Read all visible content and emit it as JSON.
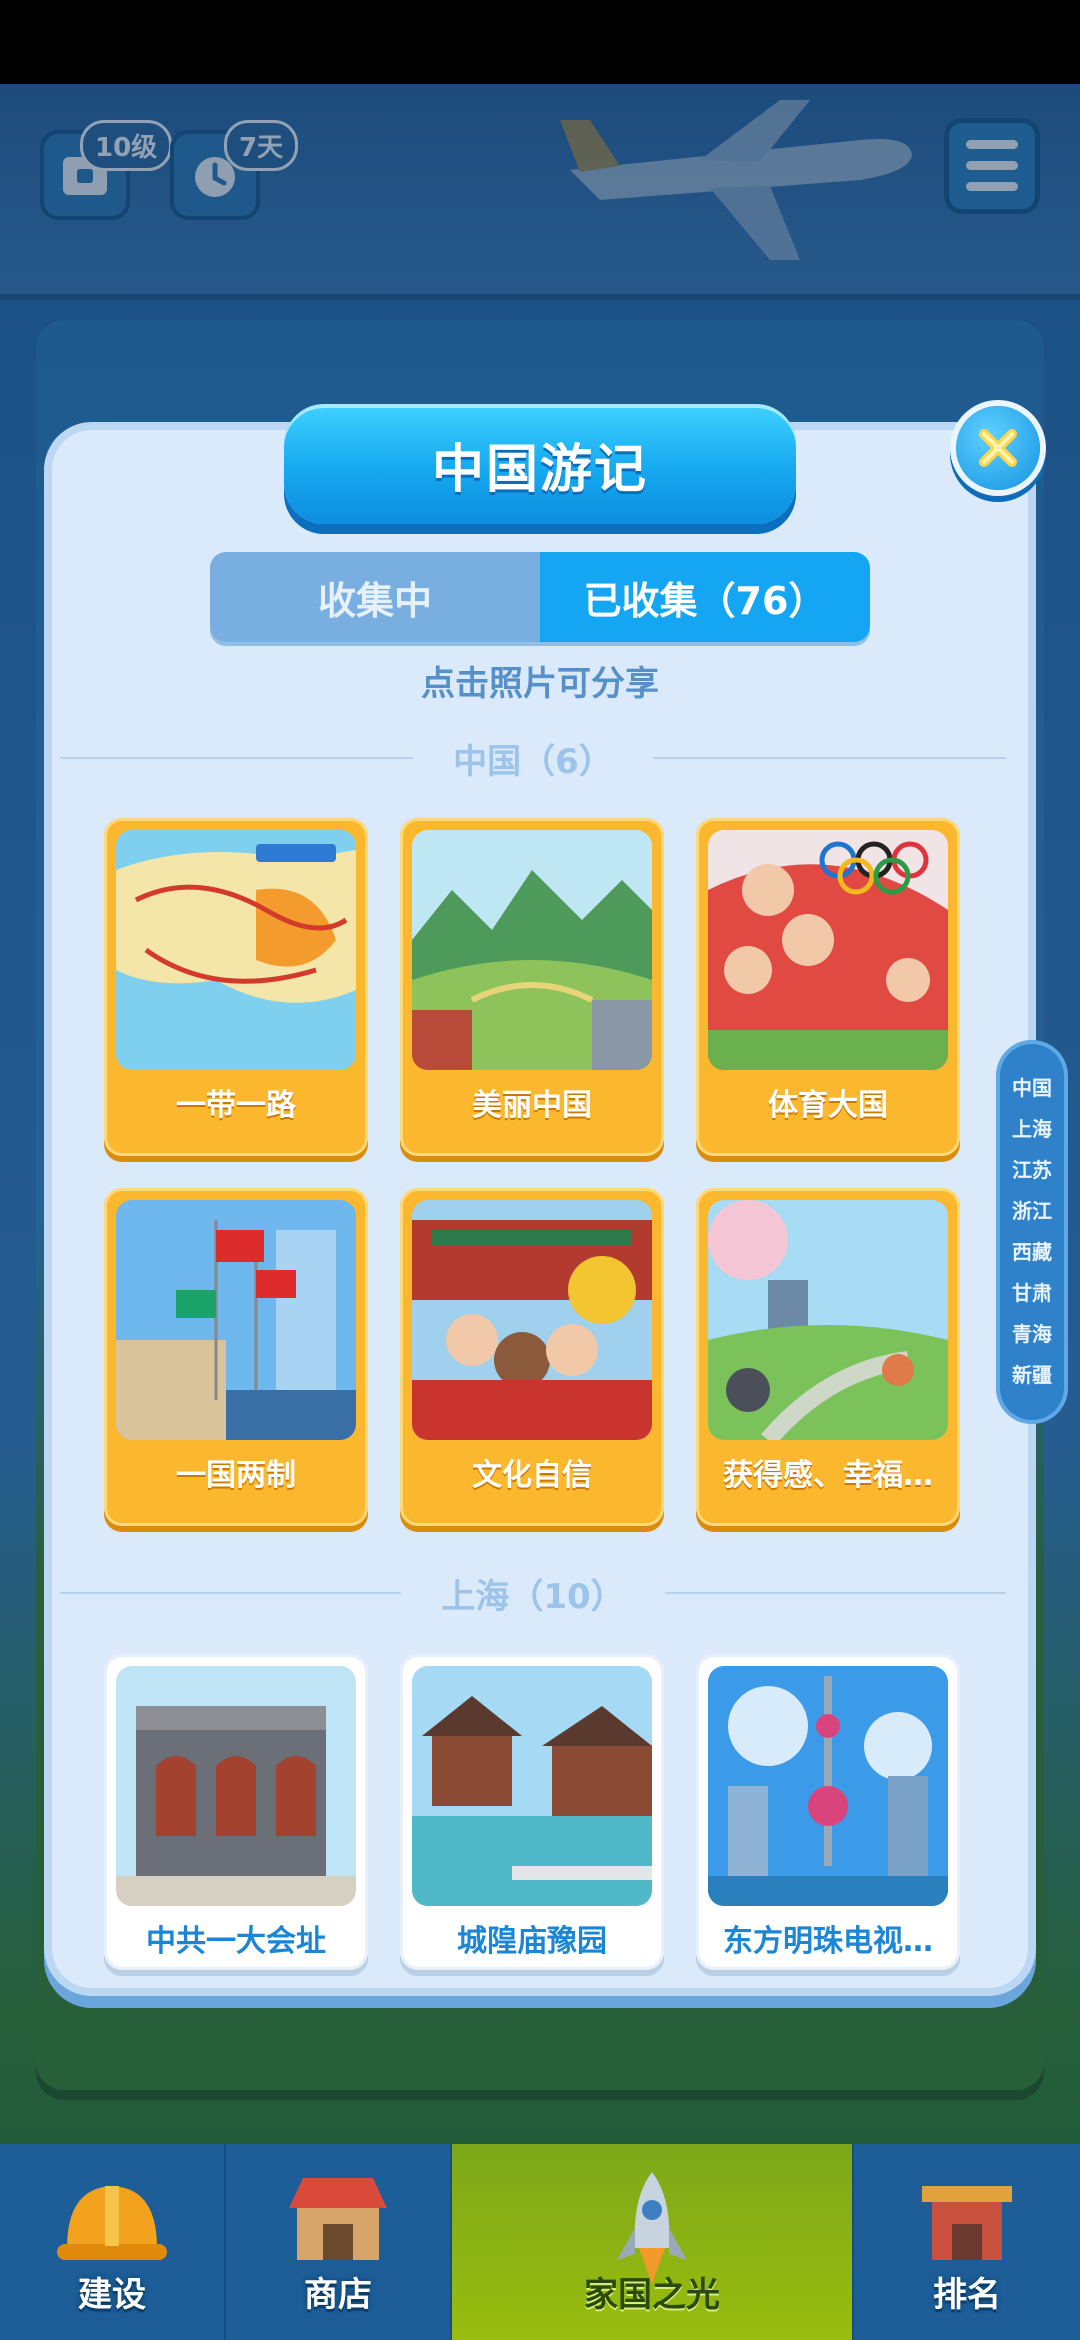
{
  "hud": {
    "level_badge": "10级",
    "days_badge": "7天"
  },
  "modal": {
    "title": "中国游记",
    "tabs": [
      {
        "label": "收集中",
        "active": false
      },
      {
        "label": "已收集（76）",
        "active": true
      }
    ],
    "hint": "点击照片可分享",
    "sections": [
      {
        "title": "中国（6）",
        "cards": [
          {
            "label": "一带一路",
            "style": "gold"
          },
          {
            "label": "美丽中国",
            "style": "gold"
          },
          {
            "label": "体育大国",
            "style": "gold"
          },
          {
            "label": "一国两制",
            "style": "gold"
          },
          {
            "label": "文化自信",
            "style": "gold"
          },
          {
            "label": "获得感、幸福…",
            "style": "gold"
          }
        ]
      },
      {
        "title": "上海（10）",
        "cards": [
          {
            "label": "中共一大会址",
            "style": "white"
          },
          {
            "label": "城隍庙豫园",
            "style": "white"
          },
          {
            "label": "东方明珠电视…",
            "style": "white"
          }
        ]
      }
    ]
  },
  "side_index": [
    "中国",
    "上海",
    "江苏",
    "浙江",
    "西藏",
    "甘肃",
    "青海",
    "新疆"
  ],
  "bottom_nav": [
    {
      "label": "建设",
      "icon": "hardhat-icon",
      "active": false
    },
    {
      "label": "商店",
      "icon": "shop-icon",
      "active": false
    },
    {
      "label": "家国之光",
      "icon": "rocket-icon",
      "active": true
    },
    {
      "label": "排名",
      "icon": "ranking-tower-icon",
      "active": false
    }
  ],
  "colors": {
    "modal_bg": "#dbeafa",
    "accent_blue": "#14a6f2",
    "card_gold": "#fbb72d",
    "nav_active": "#99bd0f"
  }
}
